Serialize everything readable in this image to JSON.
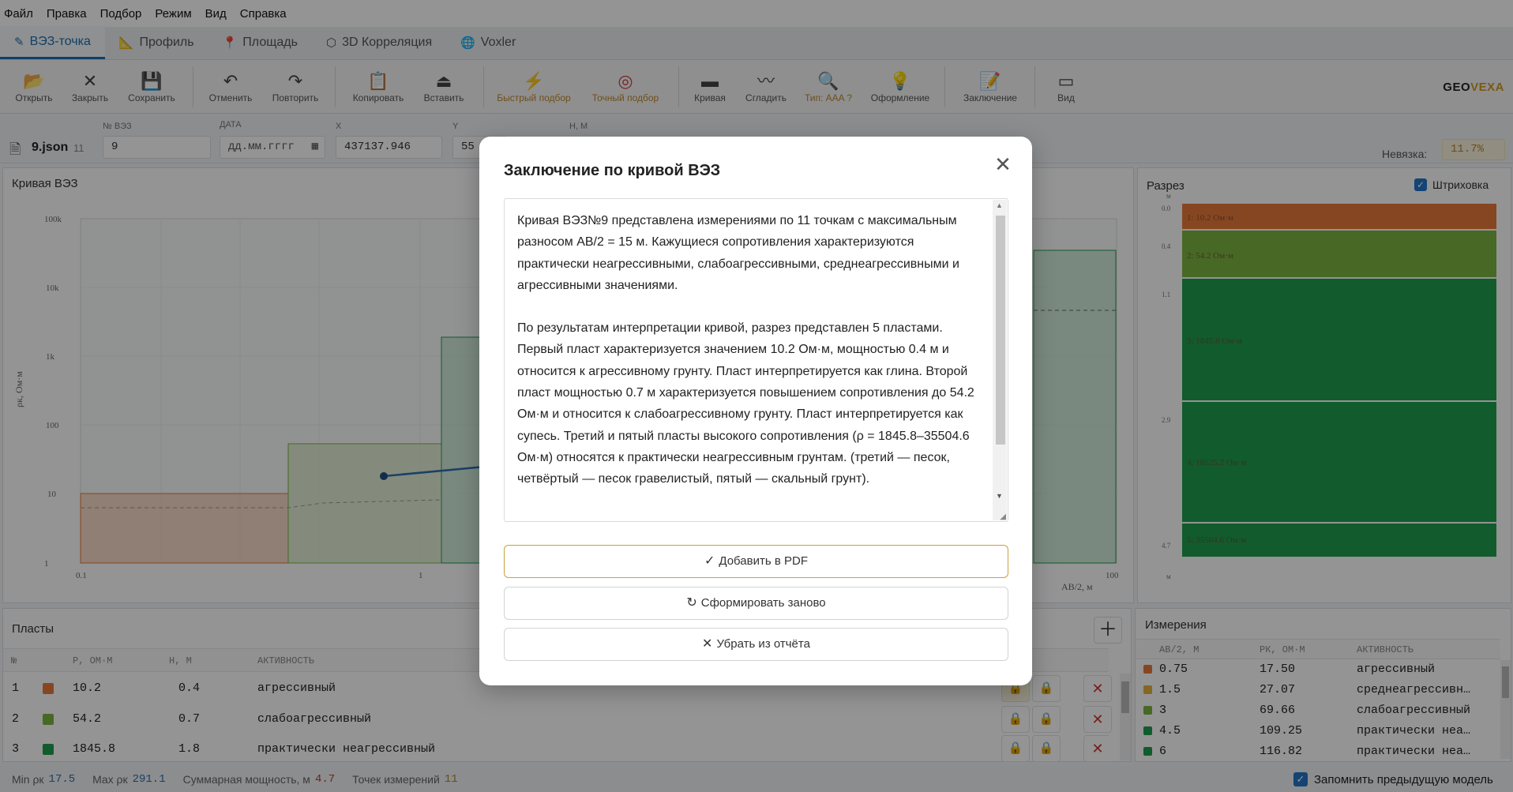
{
  "menu": [
    "Файл",
    "Правка",
    "Подбор",
    "Режим",
    "Вид",
    "Справка"
  ],
  "tabs": [
    {
      "label": "ВЭЗ-точка",
      "icon": "pencil-icon",
      "glyph": "✎"
    },
    {
      "label": "Профиль",
      "icon": "ruler-icon",
      "glyph": "📐"
    },
    {
      "label": "Площадь",
      "icon": "pin-icon",
      "glyph": "📍"
    },
    {
      "label": "3D Корреляция",
      "icon": "cube-icon",
      "glyph": "⬡"
    },
    {
      "label": "Voxler",
      "icon": "globe-icon",
      "glyph": "🌐"
    }
  ],
  "toolbar": {
    "open": "Открыть",
    "close": "Закрыть",
    "save": "Сохранить",
    "undo": "Отменить",
    "redo": "Повторить",
    "copy": "Копировать",
    "paste": "Вставить",
    "quick_fit": "Быстрый подбор",
    "exact_fit": "Точный подбор",
    "curve": "Кривая",
    "smooth": "Сгладить",
    "type": "Тип: AAA ?",
    "design": "Оформление",
    "conclusion": "Заключение",
    "view": "Вид"
  },
  "logo": {
    "part1": "GEO",
    "part2": "VEXA"
  },
  "params": {
    "file": "9.json",
    "file_count": "11",
    "vez_label": "№ ВЭЗ",
    "vez_value": "9",
    "date_label": "ДАТА",
    "date_placeholder": "дд.мм.гггг",
    "x_label": "X",
    "x_value": "437137.946",
    "y_label": "Y",
    "y_value": "55",
    "h_label": "H, М",
    "misfit_label": "Невязка:",
    "misfit_value": "11.7%"
  },
  "panels": {
    "curve_title": "Кривая ВЭЗ",
    "section_title": "Разрез",
    "hatch_label": "Штриховка",
    "layers_title": "Пласты",
    "measure_title": "Измерения"
  },
  "curve_axes": {
    "y_ticks": [
      "100k",
      "10k",
      "1k",
      "100",
      "10",
      "1"
    ],
    "x_ticks": [
      "0.1",
      "1",
      "100"
    ],
    "ylabel": "ρк, Ом·м",
    "xlabel": "AB/2, м"
  },
  "section": {
    "depths": [
      "м",
      "0.0",
      "0.4",
      "1.1",
      "2.9",
      "4.7",
      "м"
    ],
    "labels": [
      "1: 10.2 Ом·м",
      "2: 54.2 Ом·м",
      "3: 1845.8 Ом·м",
      "4: 18525.2 Ом·м",
      "5: 35504.6 Ом·м"
    ]
  },
  "layers_table": {
    "headers": [
      "№",
      "",
      "Р, ОМ·М",
      "Н, М",
      "АКТИВНОСТЬ"
    ],
    "rows": [
      {
        "n": "1",
        "color": "#e8793c",
        "rho": "10.2",
        "h": "0.4",
        "act": "агрессивный"
      },
      {
        "n": "2",
        "color": "#7cb342",
        "rho": "54.2",
        "h": "0.7",
        "act": "слабоагрессивный"
      },
      {
        "n": "3",
        "color": "#1e9e4e",
        "rho": "1845.8",
        "h": "1.8",
        "act": "практически неагрессивный"
      }
    ]
  },
  "measure_table": {
    "headers": [
      "AB/2, М",
      "РК, ОМ·М",
      "АКТИВНОСТЬ"
    ],
    "rows": [
      {
        "color": "#e8793c",
        "ab": "0.75",
        "rk": "17.50",
        "act": "агрессивный"
      },
      {
        "color": "#e3b23c",
        "ab": "1.5",
        "rk": "27.07",
        "act": "среднеагрессивн…"
      },
      {
        "color": "#7cb342",
        "ab": "3",
        "rk": "69.66",
        "act": "слабоагрессивный"
      },
      {
        "color": "#1e9e4e",
        "ab": "4.5",
        "rk": "109.25",
        "act": "практически неа…"
      },
      {
        "color": "#1e9e4e",
        "ab": "6",
        "rk": "116.82",
        "act": "практически неа…"
      }
    ]
  },
  "status": {
    "min_label": "Min ρк",
    "min_value": "17.5",
    "max_label": "Max ρк",
    "max_value": "291.1",
    "sum_label": "Суммарная мощность, м",
    "sum_value": "4.7",
    "points_label": "Точек измерений",
    "points_value": "11",
    "remember_label": "Запомнить предыдущую модель"
  },
  "modal": {
    "title": "Заключение по кривой ВЭЗ",
    "paragraph1": "Кривая ВЭЗ№9 представлена измерениями по 11 точкам с максимальным разносом AB/2 = 15 м. Кажущиеся сопротивления характеризуются практически неагрессивными, слабоагрессивными, среднеагрессивными и агрессивными значениями.",
    "paragraph2": "По результатам интерпретации кривой, разрез представлен 5 пластами. Первый пласт характеризуется значением 10.2 Ом·м, мощностью 0.4 м и относится к агрессивному грунту. Пласт интерпретируется как глина. Второй пласт мощностью 0.7 м характеризуется повышением сопротивления до 54.2 Ом·м и относится к слабоагрессивному грунту. Пласт интерпретируется как супесь. Третий и пятый пласты высокого сопротивления (ρ = 1845.8–35504.6 Ом·м) относятся к практически неагрессивным грунтам. (третий — песок, четвёртый — песок гравелистый, пятый — скальный грунт).",
    "btn_pdf": "Добавить в PDF",
    "btn_regen": "Сформировать заново",
    "btn_remove": "Убрать из отчёта"
  }
}
